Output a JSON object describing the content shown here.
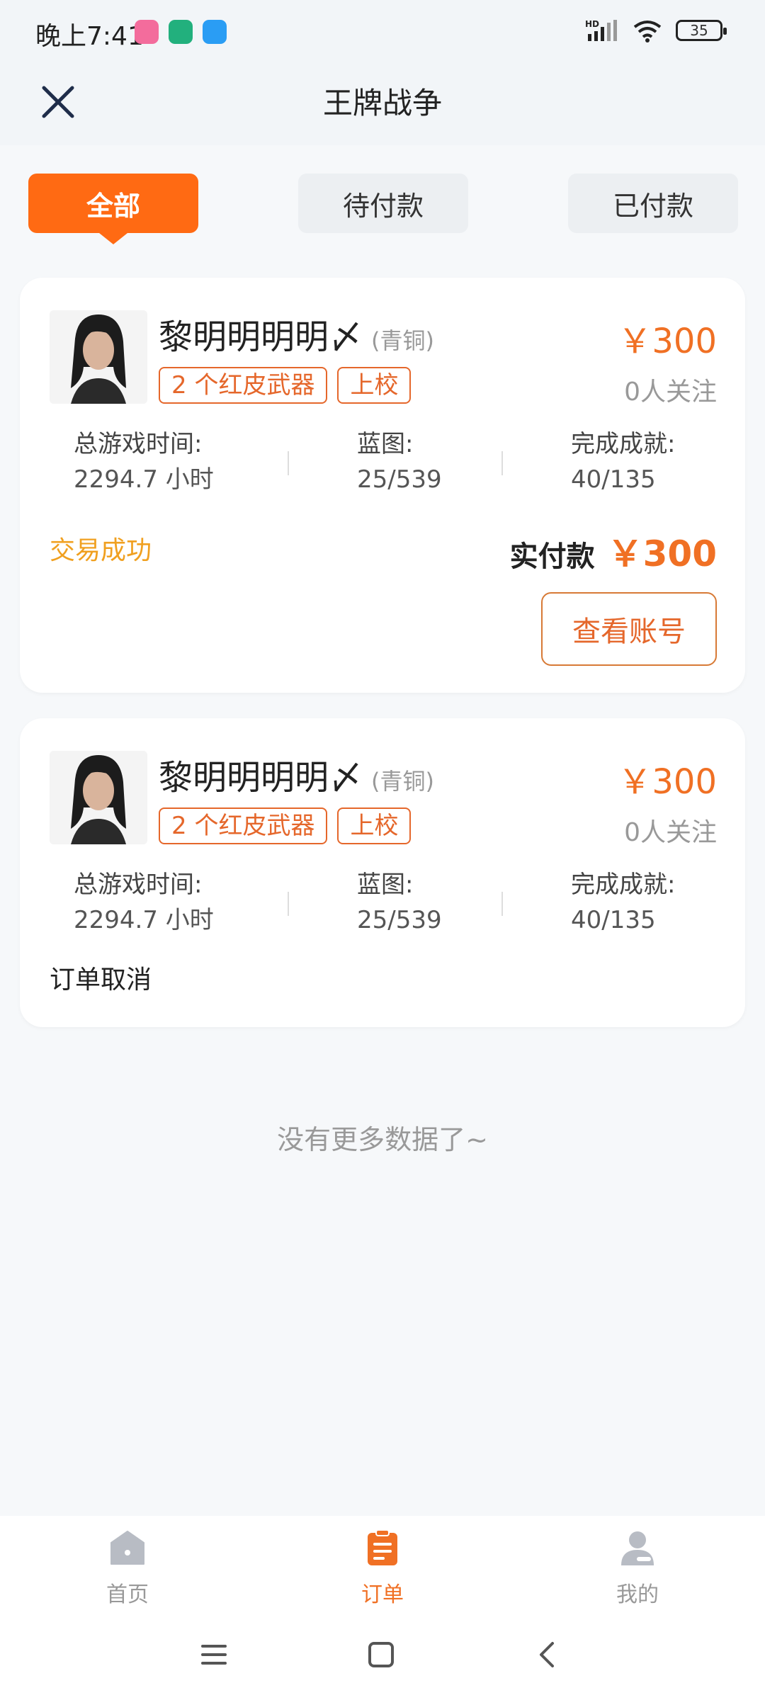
{
  "status_bar": {
    "time": "晚上7:41",
    "battery": "35",
    "network": "HD"
  },
  "header": {
    "title": "王牌战争"
  },
  "tabs": [
    {
      "label": "全部",
      "active": true
    },
    {
      "label": "待付款",
      "active": false
    },
    {
      "label": "已付款",
      "active": false
    }
  ],
  "orders": [
    {
      "name": "黎明明明明〆",
      "rank": "(青铜)",
      "tags": [
        "2 个红皮武器",
        "上校"
      ],
      "price": "￥300",
      "followers": "0人关注",
      "stats": {
        "play_time_label": "总游戏时间:",
        "play_time_value": "2294.7 小时",
        "blueprint_label": "蓝图:",
        "blueprint_value": "25/539",
        "achievement_label": "完成成就:",
        "achievement_value": "40/135"
      },
      "status": "交易成功",
      "status_color": "#f0a020",
      "paid_label": "实付款",
      "paid_amount": "￥300",
      "view_button": "查看账号"
    },
    {
      "name": "黎明明明明〆",
      "rank": "(青铜)",
      "tags": [
        "2 个红皮武器",
        "上校"
      ],
      "price": "￥300",
      "followers": "0人关注",
      "stats": {
        "play_time_label": "总游戏时间:",
        "play_time_value": "2294.7 小时",
        "blueprint_label": "蓝图:",
        "blueprint_value": "25/539",
        "achievement_label": "完成成就:",
        "achievement_value": "40/135"
      },
      "status": "订单取消",
      "status_color": "#222222"
    }
  ],
  "no_more": "没有更多数据了~",
  "bottom_nav": [
    {
      "label": "首页",
      "icon": "home-icon",
      "active": false
    },
    {
      "label": "订单",
      "icon": "order-icon",
      "active": true
    },
    {
      "label": "我的",
      "icon": "profile-icon",
      "active": false
    }
  ],
  "colors": {
    "accent": "#ff6a13",
    "price": "#f07024"
  }
}
